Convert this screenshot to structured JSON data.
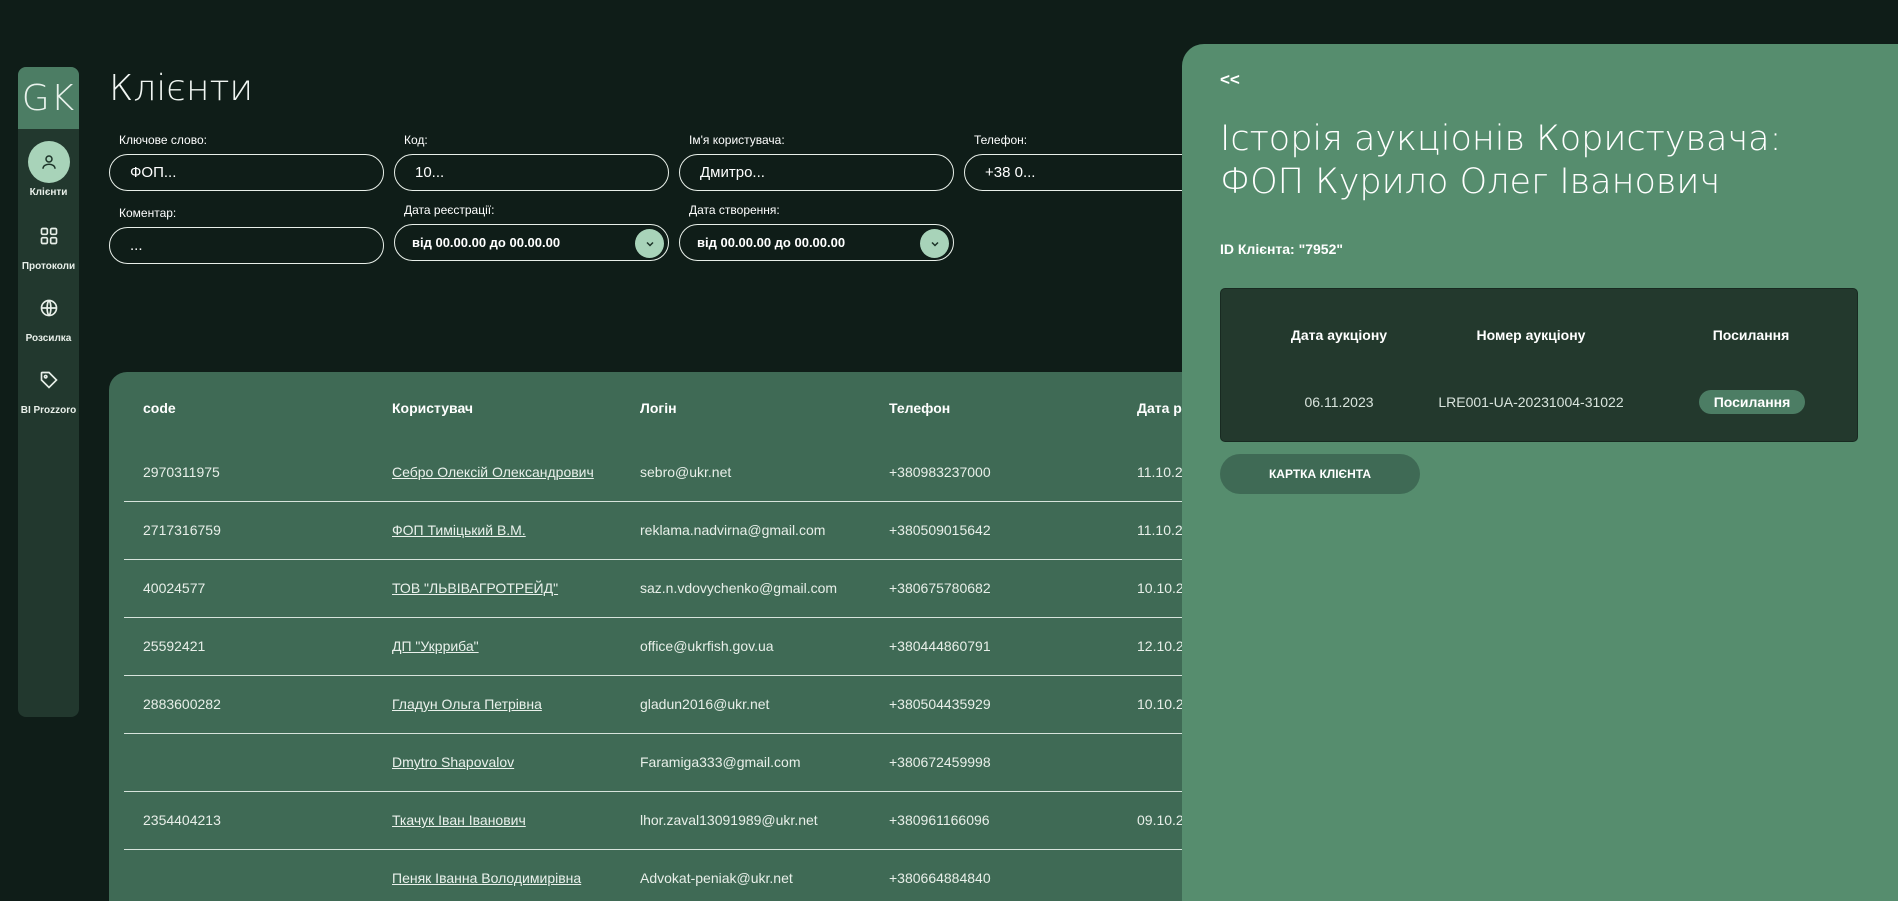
{
  "app": {
    "logo": "GK"
  },
  "sidebar": {
    "items": [
      {
        "label": "Клієнти",
        "icon": "user-icon",
        "active": true
      },
      {
        "label": "Протоколи",
        "icon": "grid-icon",
        "active": false
      },
      {
        "label": "Розсилка",
        "icon": "globe-icon",
        "active": false
      },
      {
        "label": "BI Prozzoro",
        "icon": "tag-icon",
        "active": false
      }
    ]
  },
  "page": {
    "title": "Клієнти"
  },
  "filters": {
    "keyword": {
      "label": "Ключове слово:",
      "value": "ФОП..."
    },
    "code": {
      "label": "Код:",
      "value": "10..."
    },
    "username": {
      "label": "Ім'я користувача:",
      "value": "Дмитро..."
    },
    "phone": {
      "label": "Телефон:",
      "value": "+38 0..."
    },
    "comment": {
      "label": "Коментар:",
      "value": "..."
    },
    "reg_date": {
      "label": "Дата реєстрації:",
      "value": "від 00.00.00 до 00.00.00"
    },
    "created_date": {
      "label": "Дата створення:",
      "value": "від 00.00.00 до 00.00.00"
    }
  },
  "table": {
    "headers": [
      "code",
      "Користувач",
      "Логін",
      "Телефон",
      "Дата ре"
    ],
    "rows": [
      {
        "code": "2970311975",
        "user": "Себро Олексій Олександрович",
        "login": "sebro@ukr.net",
        "phone": "+380983237000",
        "date": "11.10.2"
      },
      {
        "code": "2717316759",
        "user": "ФОП Тиміцький В.М.",
        "login": "reklama.nadvirna@gmail.com",
        "phone": "+380509015642",
        "date": "11.10.2"
      },
      {
        "code": "40024577",
        "user": "ТОВ \"ЛЬВІВАГРОТРЕЙД\"",
        "login": "saz.n.vdovychenko@gmail.com",
        "phone": "+380675780682",
        "date": "10.10.2"
      },
      {
        "code": "25592421",
        "user": "ДП \"Укрриба\"",
        "login": "office@ukrfish.gov.ua",
        "phone": "+380444860791",
        "date": "12.10.2"
      },
      {
        "code": "2883600282",
        "user": "Гладун Ольга Петрівна",
        "login": "gladun2016@ukr.net",
        "phone": "+380504435929",
        "date": "10.10.2"
      },
      {
        "code": "",
        "user": "Dmytro Shapovalov",
        "login": "Faramiga333@gmail.com",
        "phone": "+380672459998",
        "date": ""
      },
      {
        "code": "2354404213",
        "user": "Ткачук Іван Іванович",
        "login": "lhor.zaval13091989@ukr.net",
        "phone": "+380961166096",
        "date": "09.10.2"
      },
      {
        "code": "",
        "user": "Пеняк Іванна Володимирівна",
        "login": "Advokat-peniak@ukr.net",
        "phone": "+380664884840",
        "date": ""
      }
    ]
  },
  "panel": {
    "back": "<<",
    "title_line1": "Історія аукціонів Користувача:",
    "title_line2": "ФОП Курило Олег Іванович",
    "client_id": "ID Клієнта: \"7952\"",
    "auction_headers": [
      "Дата аукціону",
      "Номер аукціону",
      "Посилання"
    ],
    "auctions": [
      {
        "date": "06.11.2023",
        "number": "LRE001-UA-20231004-31022",
        "link": "Посилання"
      }
    ],
    "card_button": "КАРТКА КЛІЄНТА"
  },
  "colors": {
    "background": "#0f1d18",
    "sidebar": "#22382e",
    "accent": "#a8d3b9",
    "table": "#3f6a55",
    "panel": "#568d6e",
    "panel_table": "#23392d"
  }
}
